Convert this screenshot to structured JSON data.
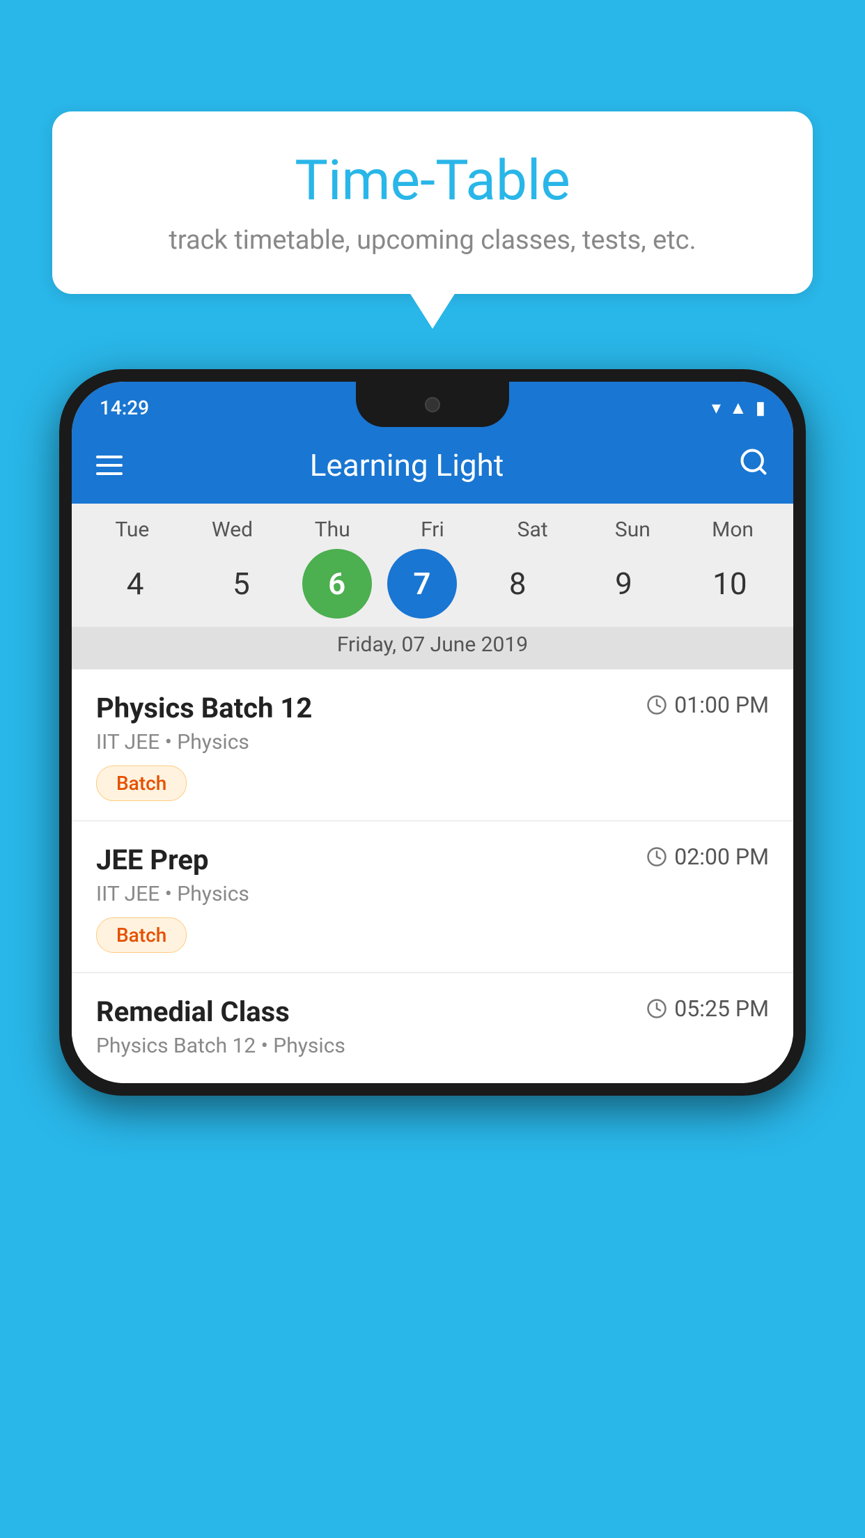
{
  "background": {
    "color": "#29B6E8"
  },
  "speech_bubble": {
    "title": "Time-Table",
    "subtitle": "track timetable, upcoming classes, tests, etc."
  },
  "phone": {
    "status_bar": {
      "time": "14:29"
    },
    "app_bar": {
      "title": "Learning Light"
    },
    "calendar": {
      "days": [
        {
          "label": "Tue",
          "num": "4"
        },
        {
          "label": "Wed",
          "num": "5"
        },
        {
          "label": "Thu",
          "num": "6",
          "state": "today"
        },
        {
          "label": "Fri",
          "num": "7",
          "state": "selected"
        },
        {
          "label": "Sat",
          "num": "8"
        },
        {
          "label": "Sun",
          "num": "9"
        },
        {
          "label": "Mon",
          "num": "10"
        }
      ],
      "selected_date_label": "Friday, 07 June 2019"
    },
    "schedule": [
      {
        "title": "Physics Batch 12",
        "time": "01:00 PM",
        "sub": "IIT JEE • Physics",
        "badge": "Batch"
      },
      {
        "title": "JEE Prep",
        "time": "02:00 PM",
        "sub": "IIT JEE • Physics",
        "badge": "Batch"
      },
      {
        "title": "Remedial Class",
        "time": "05:25 PM",
        "sub": "Physics Batch 12 • Physics"
      }
    ]
  }
}
